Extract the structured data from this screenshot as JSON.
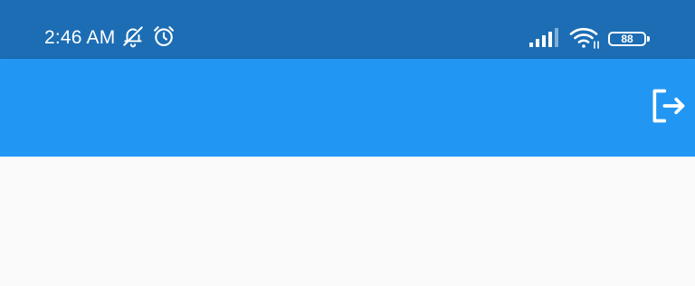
{
  "status_bar": {
    "time": "2:46 AM",
    "left_icons": [
      "bell-off-icon",
      "alarm-icon"
    ],
    "right_icons": [
      "signal-icon",
      "wifi-icon",
      "battery-icon"
    ],
    "battery_level": "88"
  },
  "app_bar": {
    "actions": [
      "logout-icon"
    ]
  },
  "colors": {
    "status_bar_bg": "#1c6db4",
    "app_bar_bg": "#2196f3",
    "content_bg": "#fafafa",
    "icon_fg": "#ffffff"
  }
}
